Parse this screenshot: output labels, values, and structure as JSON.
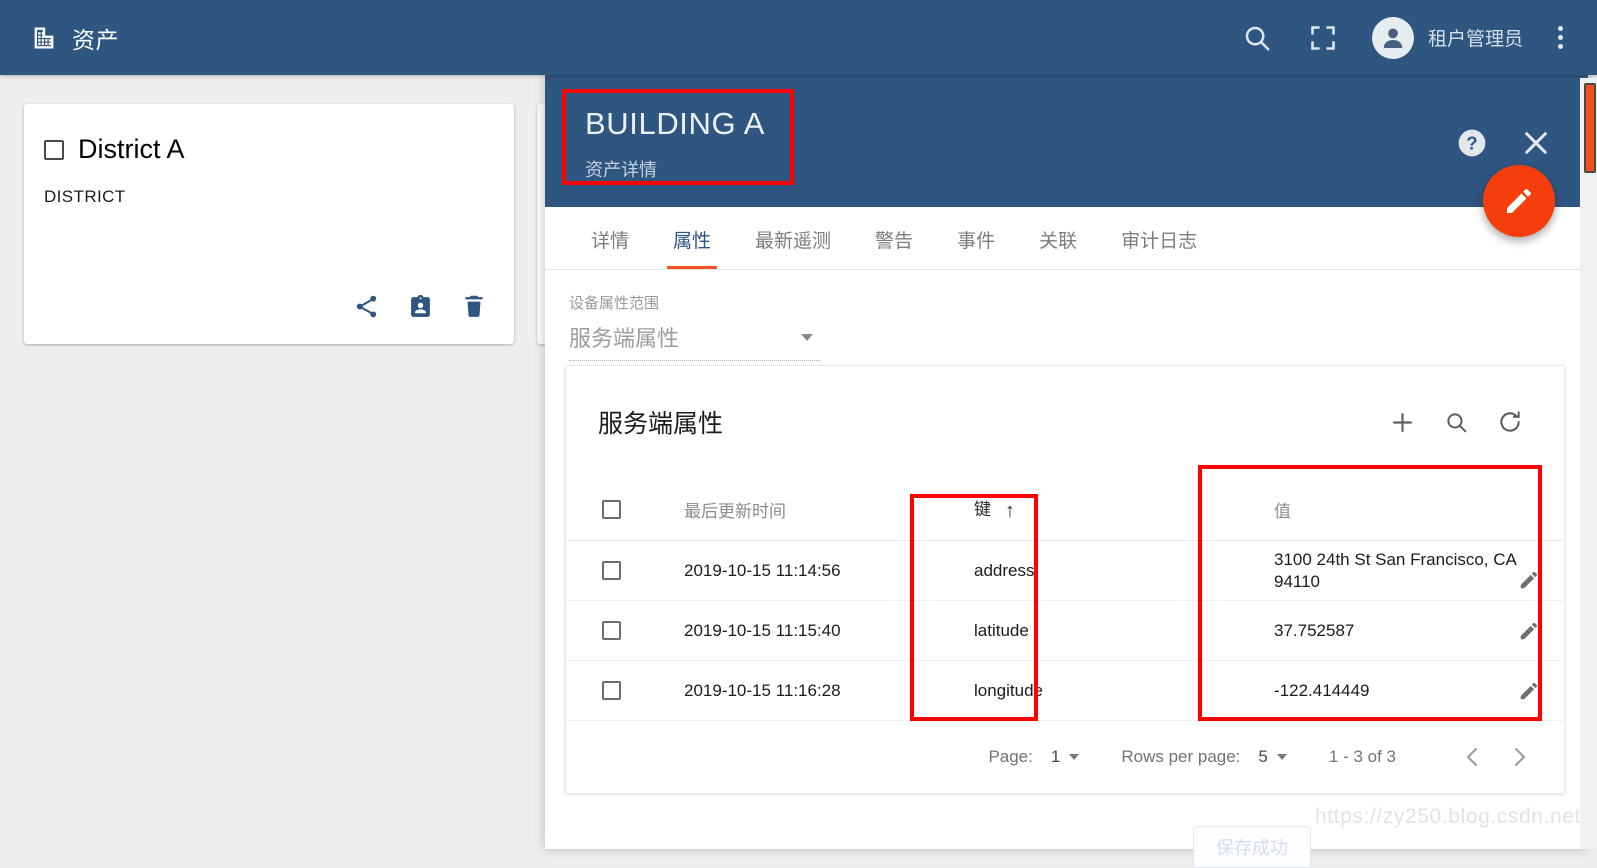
{
  "toolbar": {
    "app_title": "资产",
    "logo_icon": "building-icon",
    "search_icon": "search-icon",
    "fullscreen_icon": "fullscreen-icon",
    "avatar_icon": "account-circle-icon",
    "user_name": "租户管理员",
    "more_icon": "more-vert-icon"
  },
  "cards": [
    {
      "title": "District A",
      "subtitle": "DISTRICT",
      "checkbox_checked": false,
      "actions": [
        {
          "name": "share-icon",
          "label": "share"
        },
        {
          "name": "assignee-icon",
          "label": "manage credentials"
        },
        {
          "name": "delete-icon",
          "label": "delete"
        }
      ]
    }
  ],
  "detail": {
    "entity_name": "BUILDING A",
    "entity_kind": "资产详情",
    "help_icon": "help-icon",
    "close_icon": "close-icon",
    "edit_fab_icon": "pencil-icon",
    "tabs": [
      {
        "label": "详情",
        "active": false
      },
      {
        "label": "属性",
        "active": true
      },
      {
        "label": "最新遥测",
        "active": false
      },
      {
        "label": "警告",
        "active": false
      },
      {
        "label": "事件",
        "active": false
      },
      {
        "label": "关联",
        "active": false
      },
      {
        "label": "审计日志",
        "active": false
      }
    ],
    "scope": {
      "label": "设备属性范围",
      "value": "服务端属性",
      "caret_icon": "chevron-down-icon"
    },
    "table": {
      "title": "服务端属性",
      "actions": [
        {
          "name": "add-icon",
          "label": "+"
        },
        {
          "name": "search-icon",
          "label": "search"
        },
        {
          "name": "refresh-icon",
          "label": "refresh"
        }
      ],
      "columns": {
        "select": "",
        "last_update": "最后更新时间",
        "key": "键",
        "key_sort": "↑",
        "value": "值"
      },
      "rows": [
        {
          "last_update": "2019-10-15 11:14:56",
          "key": "address",
          "value": "3100 24th St San Francisco, CA 94110"
        },
        {
          "last_update": "2019-10-15 11:15:40",
          "key": "latitude",
          "value": "37.752587"
        },
        {
          "last_update": "2019-10-15 11:16:28",
          "key": "longitude",
          "value": "-122.414449"
        }
      ],
      "paginator": {
        "page_label": "Page:",
        "page_value": "1",
        "rows_label": "Rows per page:",
        "rows_value": "5",
        "range": "1 - 3 of 3",
        "prev_icon": "chevron-left-icon",
        "next_icon": "chevron-right-icon"
      }
    }
  },
  "toast": {
    "message": "保存成功"
  },
  "watermark": {
    "text": "https://zy250.blog.csdn.net"
  },
  "colors": {
    "primary": "#2f5681",
    "accent": "#f4511e",
    "fab": "#f63e0c",
    "annotation": "#ff0000",
    "background": "#eeeeee"
  }
}
